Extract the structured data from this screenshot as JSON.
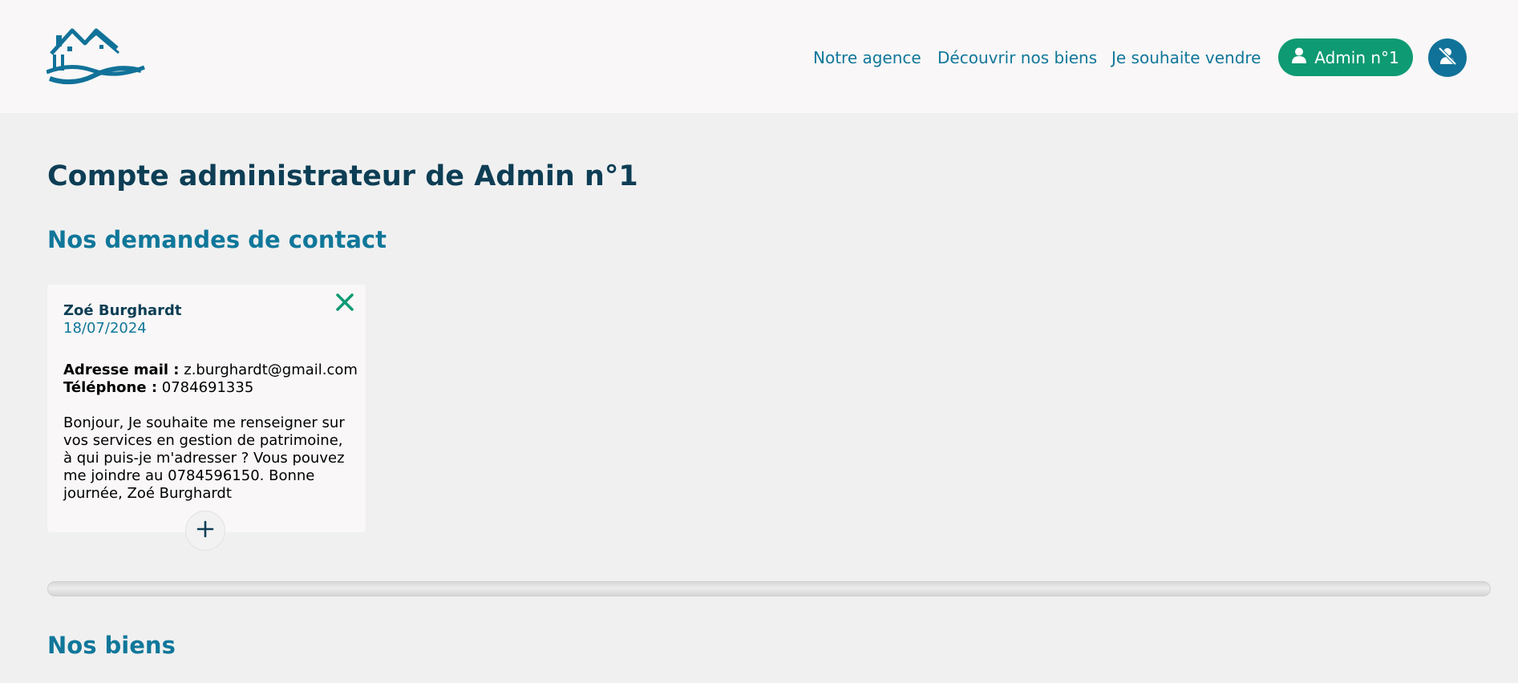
{
  "header": {
    "logo": "house-waves-logo",
    "nav": [
      {
        "label": "Notre agence"
      },
      {
        "label": "Découvrir nos biens"
      },
      {
        "label": "Je souhaite vendre"
      }
    ],
    "account_label": "Admin n°1",
    "account_icon": "user-icon",
    "logout_icon": "user-slash-icon"
  },
  "main": {
    "title": "Compte administrateur de Admin n°1",
    "contacts_title": "Nos demandes de contact",
    "contact_card": {
      "name": "Zoé Burghardt",
      "date": "18/07/2024",
      "email_label": "Adresse mail :",
      "email": "z.burghardt@gmail.com",
      "phone_label": "Téléphone :",
      "phone": "0784691335",
      "message": "Bonjour, Je souhaite me renseigner sur vos services en gestion de patrimoine, à qui puis-je m'adresser ? Vous pouvez me joindre au 0784596150. Bonne journée, Zoé Burghardt"
    },
    "properties_title": "Nos biens"
  },
  "colors": {
    "brand_teal": "#10779a",
    "dark_navy": "#0d3e55",
    "accent_green": "#0e9a73"
  }
}
